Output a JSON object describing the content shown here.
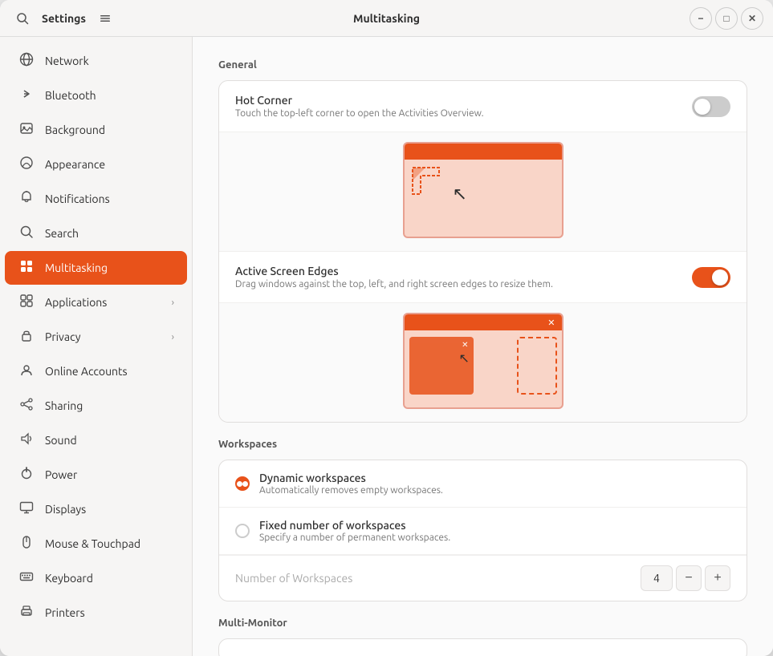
{
  "window": {
    "title": "Multitasking",
    "settings_label": "Settings",
    "minimize_label": "−",
    "maximize_label": "□",
    "close_label": "✕"
  },
  "sidebar": {
    "items": [
      {
        "id": "network",
        "label": "Network",
        "icon": "🌐",
        "has_chevron": false,
        "active": false
      },
      {
        "id": "bluetooth",
        "label": "Bluetooth",
        "icon": "⬡",
        "has_chevron": false,
        "active": false
      },
      {
        "id": "background",
        "label": "Background",
        "icon": "🖼",
        "has_chevron": false,
        "active": false
      },
      {
        "id": "appearance",
        "label": "Appearance",
        "icon": "🎨",
        "has_chevron": false,
        "active": false
      },
      {
        "id": "notifications",
        "label": "Notifications",
        "icon": "🔔",
        "has_chevron": false,
        "active": false
      },
      {
        "id": "search",
        "label": "Search",
        "icon": "🔍",
        "has_chevron": false,
        "active": false
      },
      {
        "id": "multitasking",
        "label": "Multitasking",
        "icon": "⊞",
        "has_chevron": false,
        "active": true
      },
      {
        "id": "applications",
        "label": "Applications",
        "icon": "⊞",
        "has_chevron": true,
        "active": false
      },
      {
        "id": "privacy",
        "label": "Privacy",
        "icon": "🔒",
        "has_chevron": true,
        "active": false
      },
      {
        "id": "online-accounts",
        "label": "Online Accounts",
        "icon": "☁",
        "has_chevron": false,
        "active": false
      },
      {
        "id": "sharing",
        "label": "Sharing",
        "icon": "↗",
        "has_chevron": false,
        "active": false
      },
      {
        "id": "sound",
        "label": "Sound",
        "icon": "♪",
        "has_chevron": false,
        "active": false
      },
      {
        "id": "power",
        "label": "Power",
        "icon": "⏻",
        "has_chevron": false,
        "active": false
      },
      {
        "id": "displays",
        "label": "Displays",
        "icon": "🖥",
        "has_chevron": false,
        "active": false
      },
      {
        "id": "mouse-touchpad",
        "label": "Mouse & Touchpad",
        "icon": "🖱",
        "has_chevron": false,
        "active": false
      },
      {
        "id": "keyboard",
        "label": "Keyboard",
        "icon": "⌨",
        "has_chevron": false,
        "active": false
      },
      {
        "id": "printers",
        "label": "Printers",
        "icon": "🖨",
        "has_chevron": false,
        "active": false
      }
    ]
  },
  "main": {
    "general_section": "General",
    "hot_corner": {
      "title": "Hot Corner",
      "description": "Touch the top-left corner to open the Activities Overview.",
      "toggle_state": "off"
    },
    "active_screen_edges": {
      "title": "Active Screen Edges",
      "description": "Drag windows against the top, left, and right screen edges to resize them.",
      "toggle_state": "on"
    },
    "workspaces_section": "Workspaces",
    "dynamic_workspaces": {
      "title": "Dynamic workspaces",
      "description": "Automatically removes empty workspaces.",
      "selected": true
    },
    "fixed_workspaces": {
      "title": "Fixed number of workspaces",
      "description": "Specify a number of permanent workspaces.",
      "selected": false
    },
    "number_of_workspaces_label": "Number of Workspaces",
    "workspace_count": "4",
    "decrease_label": "−",
    "increase_label": "+",
    "multi_monitor_section": "Multi-Monitor"
  }
}
